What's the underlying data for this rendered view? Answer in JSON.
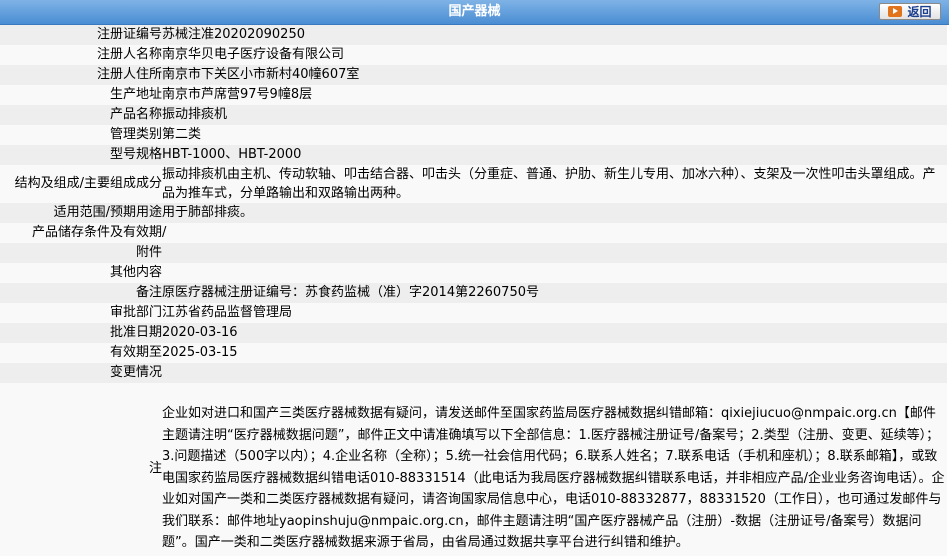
{
  "header": {
    "title": "国产器械",
    "back_label": "返回"
  },
  "rows": [
    {
      "label": "注册证编号",
      "value": "苏械注准20202090250"
    },
    {
      "label": "注册人名称",
      "value": "南京华贝电子医疗设备有限公司"
    },
    {
      "label": "注册人住所",
      "value": "南京市下关区小市新村40幢607室"
    },
    {
      "label": "生产地址",
      "value": "南京市芦席营97号9幢8层"
    },
    {
      "label": "产品名称",
      "value": "振动排痰机"
    },
    {
      "label": "管理类别",
      "value": "第二类"
    },
    {
      "label": "型号规格",
      "value": "HBT-1000、HBT-2000"
    },
    {
      "label": "结构及组成/主要组成成分",
      "value": "振动排痰机由主机、传动软轴、叩击结合器、叩击头（分重症、普通、护肋、新生儿专用、加冰六种）、支架及一次性叩击头罩组成。产品为推车式，分单路输出和双路输出两种。"
    },
    {
      "label": "适用范围/预期用途",
      "value": "用于肺部排痰。"
    },
    {
      "label": "产品储存条件及有效期",
      "value": "/"
    },
    {
      "label": "附件",
      "value": ""
    },
    {
      "label": "其他内容",
      "value": ""
    },
    {
      "label": "备注",
      "value": "原医疗器械注册证编号：苏食药监械（准）字2014第2260750号"
    },
    {
      "label": "审批部门",
      "value": "江苏省药品监督管理局"
    },
    {
      "label": "批准日期",
      "value": "2020-03-16"
    },
    {
      "label": "有效期至",
      "value": "2025-03-15"
    },
    {
      "label": "变更情况",
      "value": ""
    }
  ],
  "note": {
    "label": "注",
    "text": "企业如对进口和国产三类医疗器械数据有疑问，请发送邮件至国家药监局医疗器械数据纠错邮箱：qixiejiucuo@nmpaic.org.cn【邮件主题请注明“医疗器械数据问题”，邮件正文中请准确填写以下全部信息：1.医疗器械注册证号/备案号；2.类型（注册、变更、延续等）；3.问题描述（500字以内）；4.企业名称（全称）；5.统一社会信用代码；6.联系人姓名；7.联系电话（手机和座机）；8.联系邮箱】，或致电国家药监局医疗器械数据纠错电话010-88331514（此电话为我局医疗器械数据纠错联系电话，并非相应产品/企业业务咨询电话）。企业如对国产一类和二类医疗器械数据有疑问，请咨询国家局信息中心，电话010-88332877，88331520（工作日），也可通过发邮件与我们联系：邮件地址yaopinshuju@nmpaic.org.cn，邮件主题请注明“国产医疗器械产品（注册）-数据（注册证号/备案号）数据问题”。国产一类和二类医疗器械数据来源于省局，由省局通过数据共享平台进行纠错和维护。"
  }
}
